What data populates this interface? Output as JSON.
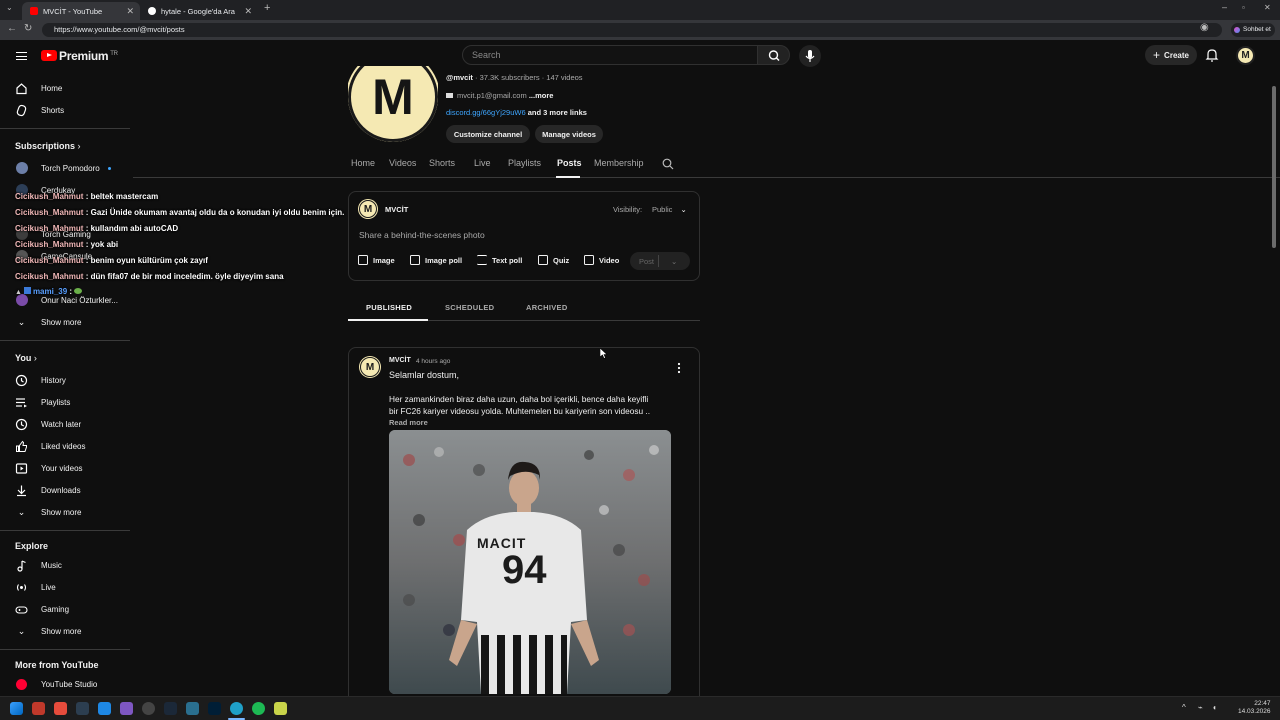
{
  "browser": {
    "tabs": [
      {
        "title": "MVCİT - YouTube",
        "active": true
      },
      {
        "title": "hytale - Google'da Ara",
        "active": false
      }
    ],
    "url": "https://www.youtube.com/@mvcit/posts",
    "chat_button": "Sohbet et"
  },
  "header": {
    "brand": "Premium",
    "region": "TR",
    "search_placeholder": "Search",
    "create_label": "Create",
    "avatar_letter": "M"
  },
  "sidebar": {
    "main": [
      {
        "label": "Home",
        "icon": "home-icon"
      },
      {
        "label": "Shorts",
        "icon": "shorts-icon"
      }
    ],
    "subscriptions_title": "Subscriptions",
    "subscriptions": [
      {
        "label": "Torch Pomodoro",
        "live_dot": true
      },
      {
        "label": "Cerdukay"
      },
      {
        "label": "Torch Gaming"
      },
      {
        "label": "GameCapsule"
      },
      {
        "label": "Onur Naci Özturkler..."
      }
    ],
    "subs_show_more": "Show more",
    "you_title": "You",
    "you": [
      {
        "label": "History",
        "icon": "history-icon"
      },
      {
        "label": "Playlists",
        "icon": "playlists-icon"
      },
      {
        "label": "Watch later",
        "icon": "watch-later-icon"
      },
      {
        "label": "Liked videos",
        "icon": "thumbs-up-icon"
      },
      {
        "label": "Your videos",
        "icon": "your-videos-icon"
      },
      {
        "label": "Downloads",
        "icon": "download-icon"
      }
    ],
    "you_show_more": "Show more",
    "explore_title": "Explore",
    "explore": [
      {
        "label": "Music",
        "icon": "music-icon"
      },
      {
        "label": "Live",
        "icon": "live-icon"
      },
      {
        "label": "Gaming",
        "icon": "gaming-icon"
      }
    ],
    "explore_show_more": "Show more",
    "more_title": "More from YouTube",
    "more": [
      {
        "label": "YouTube Studio",
        "icon": "youtube-studio-icon"
      }
    ]
  },
  "chat_overlay": [
    {
      "user": "Cicikush_Mahmut",
      "msg": ": beltek mastercam"
    },
    {
      "user": "Cicikush_Mahmut",
      "msg": ": Gazi Ünide okumam avantaj oldu da o konudan iyi oldu benim için."
    },
    {
      "user": "Cicikush_Mahmut",
      "msg": ": kullandım abi autoCAD"
    },
    {
      "user": "Cicikush_Mahmut",
      "msg": ": yok abi"
    },
    {
      "user": "Cicikush_Mahmut",
      "msg": ": benim oyun kültürüm çok zayıf"
    },
    {
      "user": "Cicikush_Mahmut",
      "msg": ": dün fifa07 de bir mod inceledim. öyle diyeyim sana"
    },
    {
      "user": "mami_39",
      "msg": ":"
    }
  ],
  "channel": {
    "logo_letter": "M",
    "handle": "@mvcit",
    "stats": "· 37.3K subscribers · 147 videos",
    "email": "mvcit.p1@gmail.com",
    "more": "...more",
    "link": "discord.gg/66gYj29uW6",
    "more_links": "and 3 more links",
    "customize_button": "Customize channel",
    "manage_button": "Manage videos",
    "tabs": [
      "Home",
      "Videos",
      "Shorts",
      "Live",
      "Playlists",
      "Posts",
      "Membership"
    ],
    "active_tab": "Posts"
  },
  "composer": {
    "name": "MVCİT",
    "visibility_label": "Visibility:",
    "visibility_value": "Public",
    "placeholder": "Share a behind-the-scenes photo",
    "tools": [
      "Image",
      "Image poll",
      "Text poll",
      "Quiz",
      "Video"
    ],
    "post_button": "Post"
  },
  "post_tabs": [
    "PUBLISHED",
    "SCHEDULED",
    "ARCHIVED"
  ],
  "post": {
    "author": "MVCİT",
    "time": "4 hours ago",
    "greeting": "Selamlar dostum,",
    "body_line1": "Her zamankinden biraz daha uzun, daha bol içerikli, bence daha keyifli",
    "body_line2": "bir FC26 kariyer videosu yolda. Muhtemelen bu kariyerin son videosu ..",
    "read_more": "Read more",
    "jersey_name": "MACIT",
    "jersey_number": "94"
  },
  "taskbar": {
    "time": "22:47",
    "date": "14.03.2026"
  }
}
